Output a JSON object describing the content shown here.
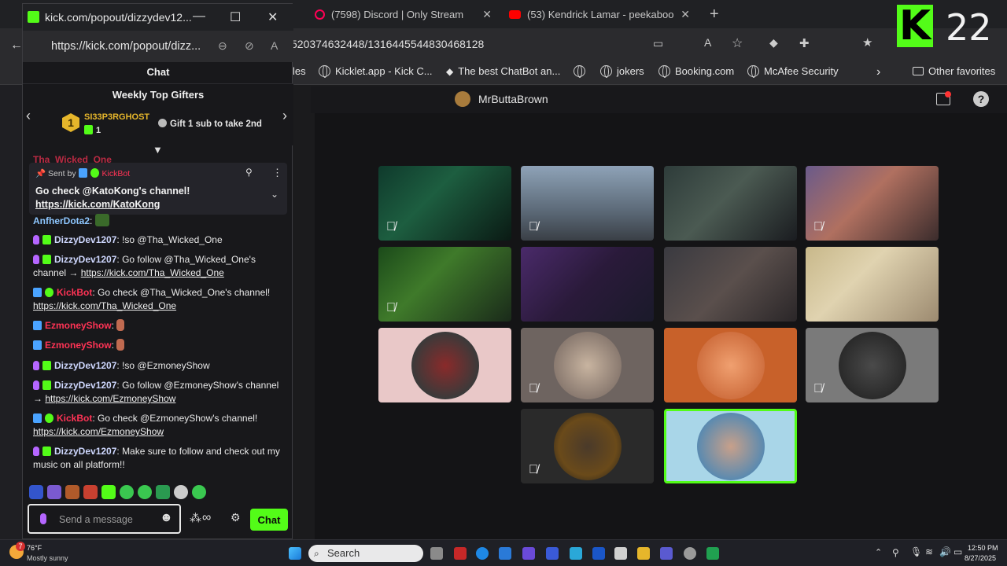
{
  "background_browser": {
    "tabs": [
      {
        "label": "(7598) Discord | Only Stream"
      },
      {
        "label": "(53) Kendrick Lamar - peekaboo"
      }
    ],
    "url_fragment": "520374632448/1316445544830468128",
    "favorites": [
      {
        "label": "les"
      },
      {
        "label": "Kicklet.app - Kick C..."
      },
      {
        "label": "The best ChatBot an..."
      },
      {
        "label": "jokers"
      },
      {
        "label": "Booking.com"
      },
      {
        "label": "McAfee Security"
      },
      {
        "label": "Other favorites"
      }
    ]
  },
  "kick_overlay": {
    "letter": "K",
    "number": "22"
  },
  "stream": {
    "host": "MrButtaBrown"
  },
  "popout": {
    "title": "kick.com/popout/dizzydev12...",
    "url": "https://kick.com/popout/dizz...",
    "chat_header": "Chat",
    "top_gifters": {
      "heading": "Weekly Top Gifters",
      "rank": "1",
      "name": "SI33P3RGHOST",
      "count": "1",
      "cta": "Gift 1 sub to take 2nd"
    },
    "pinned": {
      "sent_by_label": "Sent by",
      "sender": "KickBot",
      "message": "Go check @KatoKong's channel!",
      "link": "https://kick.com/KatoKong"
    },
    "partial_user": "Tha_Wicked_One",
    "messages": [
      {
        "user": "AnfherDota2",
        "text": ""
      },
      {
        "user": "DizzyDev1207",
        "text": "!so @Tha_Wicked_One"
      },
      {
        "user": "DizzyDev1207",
        "text": "Go follow @Tha_Wicked_One's channel →",
        "link": "https://kick.com/Tha_Wicked_One"
      },
      {
        "user": "KickBot",
        "text": "Go check @Tha_Wicked_One's channel!",
        "link": "https://kick.com/Tha_Wicked_One"
      },
      {
        "user": "EzmoneyShow",
        "text": ""
      },
      {
        "user": "EzmoneyShow",
        "text": ""
      },
      {
        "user": "DizzyDev1207",
        "text": "!so @EzmoneyShow"
      },
      {
        "user": "DizzyDev1207",
        "text": "Go follow @EzmoneyShow's channel →",
        "link": "https://kick.com/EzmoneyShow"
      },
      {
        "user": "KickBot",
        "text": "Go check @EzmoneyShow's channel!",
        "link": "https://kick.com/EzmoneyShow"
      },
      {
        "user": "DizzyDev1207",
        "text": "Make sure to follow and check out my music on all platform!!"
      }
    ],
    "composer_placeholder": "Send a message",
    "send_label": "Chat"
  },
  "taskbar": {
    "weather_temp": "76°F",
    "weather_desc": "Mostly sunny",
    "badge": "7",
    "search_label": "Search",
    "time": "12:50 PM",
    "date": "8/27/2025"
  },
  "colors": {
    "kick_green": "#53fc18",
    "kickbot_red": "#ff3355",
    "gold": "#e6b62b"
  }
}
